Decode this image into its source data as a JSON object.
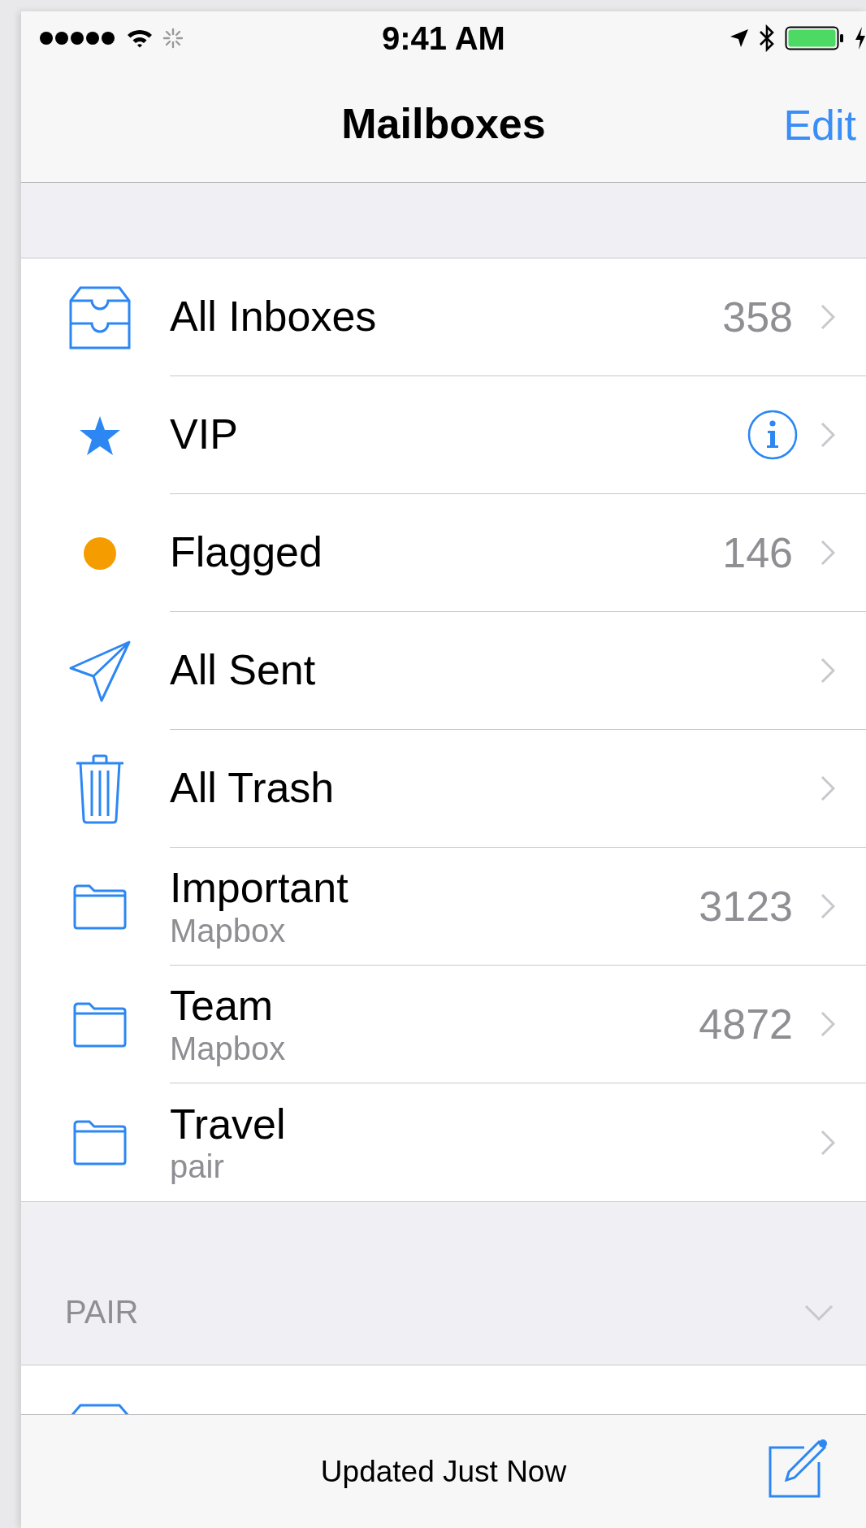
{
  "status_bar": {
    "time": "9:41 AM"
  },
  "nav_bar": {
    "title": "Mailboxes",
    "edit_button": "Edit"
  },
  "mailboxes": [
    {
      "kind": "inbox",
      "label": "All Inboxes",
      "count": "358"
    },
    {
      "kind": "vip",
      "label": "VIP",
      "info": true
    },
    {
      "kind": "flagged",
      "label": "Flagged",
      "count": "146"
    },
    {
      "kind": "sent",
      "label": "All Sent"
    },
    {
      "kind": "trash",
      "label": "All Trash"
    },
    {
      "kind": "folder",
      "label": "Important",
      "subtitle": "Mapbox",
      "count": "3123"
    },
    {
      "kind": "folder",
      "label": "Team",
      "subtitle": "Mapbox",
      "count": "4872"
    },
    {
      "kind": "folder",
      "label": "Travel",
      "subtitle": "pair"
    }
  ],
  "sections": [
    {
      "title": "PAIR",
      "expanded": true,
      "rows": [
        {
          "kind": "inbox"
        }
      ]
    }
  ],
  "toolbar": {
    "status": "Updated Just Now"
  }
}
